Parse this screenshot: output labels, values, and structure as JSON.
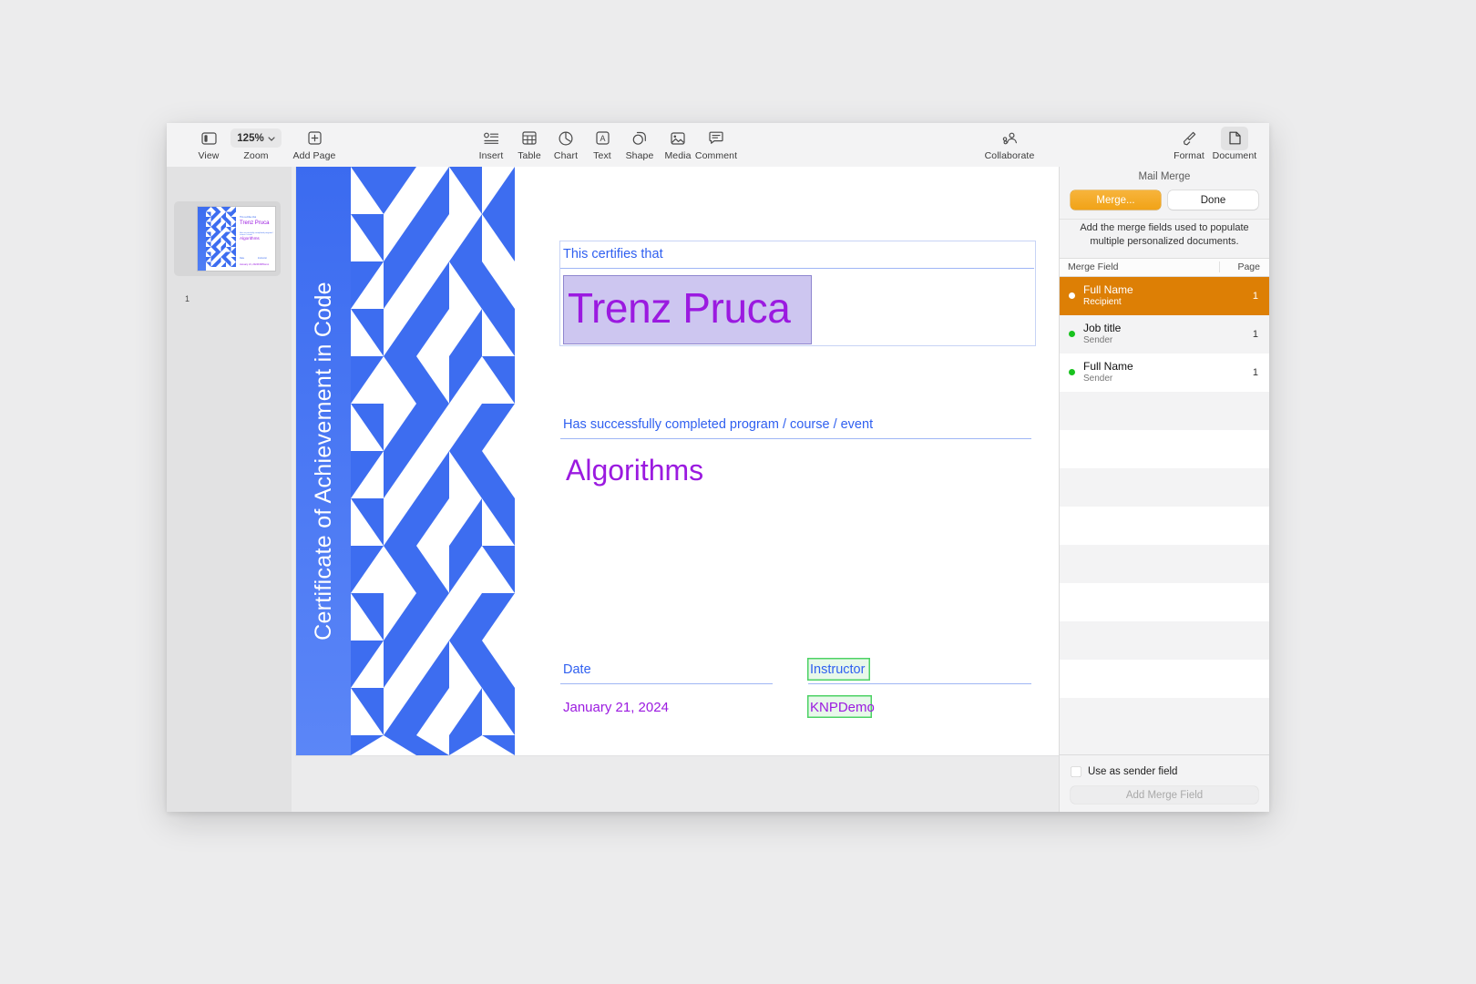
{
  "toolbar": {
    "items": [
      {
        "label": "View",
        "icon": "sidebar-icon"
      },
      {
        "label": "Zoom",
        "icon": "chevron-down-icon",
        "value": "125%"
      },
      {
        "label": "Add Page",
        "icon": "plus-square-icon"
      },
      {
        "label": "Insert",
        "icon": "insert-icon"
      },
      {
        "label": "Table",
        "icon": "table-icon"
      },
      {
        "label": "Chart",
        "icon": "chart-icon"
      },
      {
        "label": "Text",
        "icon": "text-icon"
      },
      {
        "label": "Shape",
        "icon": "shape-icon"
      },
      {
        "label": "Media",
        "icon": "media-icon"
      },
      {
        "label": "Comment",
        "icon": "comment-icon"
      },
      {
        "label": "Collaborate",
        "icon": "collaborate-icon"
      },
      {
        "label": "Format",
        "icon": "format-brush-icon"
      },
      {
        "label": "Document",
        "icon": "document-icon"
      }
    ],
    "zoom_value": "125%",
    "view_label": "View",
    "zoom_label": "Zoom",
    "add_page_label": "Add Page",
    "insert_label": "Insert",
    "table_label": "Table",
    "chart_label": "Chart",
    "text_label": "Text",
    "shape_label": "Shape",
    "media_label": "Media",
    "comment_label": "Comment",
    "collaborate_label": "Collaborate",
    "format_label": "Format",
    "document_label": "Document"
  },
  "thumbnails": {
    "page_number": "1"
  },
  "document": {
    "vertical_title": "Certificate of Achievement in Code",
    "certifies_label": "This certifies that",
    "recipient_name": "Trenz Pruca",
    "completed_label": "Has successfully completed program / course / event",
    "course_name": "Algorithms",
    "date_label": "Date",
    "date_value": "January 21, 2024",
    "instructor_label": "Instructor",
    "instructor_value": "KNPDemo",
    "accent_blue": "#3d6df0",
    "field_purple": "#9b1ae0",
    "selection_fill": "#cdc6f0",
    "merge_field_green": "#4cd264"
  },
  "inspector": {
    "title": "Mail Merge",
    "merge_button": "Merge...",
    "done_button": "Done",
    "help_text": "Add the merge fields used to populate multiple personalized documents.",
    "columns": {
      "field": "Merge Field",
      "page": "Page"
    },
    "rows": [
      {
        "name": "Full Name",
        "source": "Recipient",
        "page": "1",
        "selected": true
      },
      {
        "name": "Job title",
        "source": "Sender",
        "page": "1",
        "selected": false
      },
      {
        "name": "Full Name",
        "source": "Sender",
        "page": "1",
        "selected": false
      }
    ],
    "use_as_sender_label": "Use as sender field",
    "add_merge_field_label": "Add Merge Field",
    "selected_color": "#dd7f05",
    "accent_orange": "#f1a317"
  }
}
